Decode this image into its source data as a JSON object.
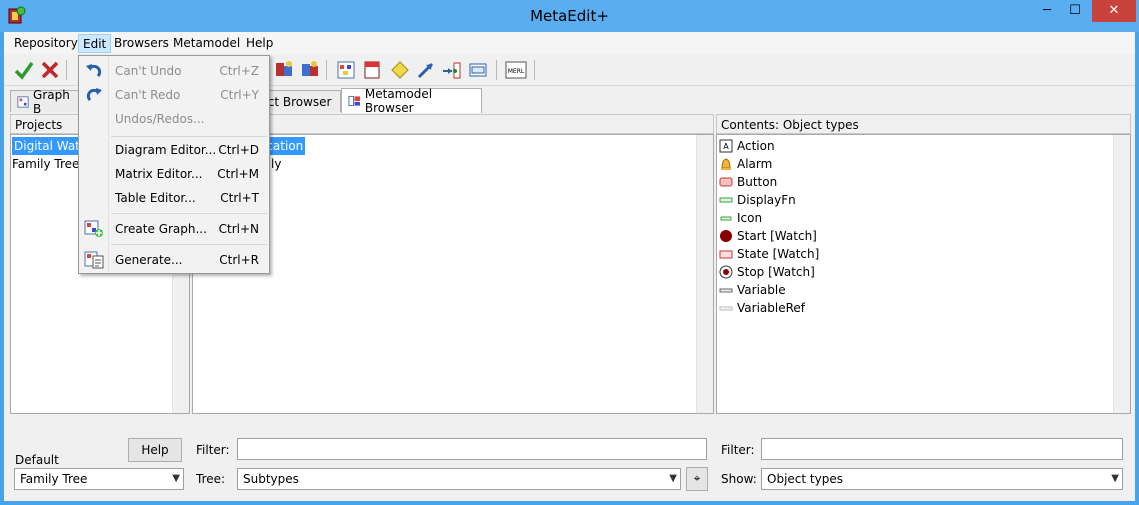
{
  "window": {
    "title": "MetaEdit+",
    "minimize": "─",
    "maximize": "☐",
    "close": "✕"
  },
  "menu": {
    "repository": "Repository",
    "edit": "Edit",
    "browsers": "Browsers",
    "metamodel": "Metamodel",
    "help": "Help"
  },
  "tabs": {
    "graph": "Graph B",
    "object": "ject Browser",
    "metamodel": "Metamodel Browser"
  },
  "projects": {
    "header": "Projects",
    "items": [
      "Digital Watch",
      "Family Tree"
    ],
    "selected": "Digital Watch",
    "default_label": "Default",
    "help_button": "Help",
    "default_value": "Family Tree"
  },
  "middle": {
    "items": [
      "ication",
      "ly"
    ],
    "filter_label": "Filter:",
    "filter_value": "",
    "tree_label": "Tree:",
    "tree_value": "Subtypes"
  },
  "contents": {
    "header": "Contents: Object types",
    "items": [
      {
        "label": "Action",
        "icon": "action-icon"
      },
      {
        "label": "Alarm",
        "icon": "alarm-icon"
      },
      {
        "label": "Button",
        "icon": "button-icon"
      },
      {
        "label": "DisplayFn",
        "icon": "displayfn-icon"
      },
      {
        "label": "Icon",
        "icon": "icon-type-icon"
      },
      {
        "label": "Start [Watch]",
        "icon": "start-icon"
      },
      {
        "label": "State [Watch]",
        "icon": "state-icon"
      },
      {
        "label": "Stop [Watch]",
        "icon": "stop-icon"
      },
      {
        "label": "Variable",
        "icon": "variable-icon"
      },
      {
        "label": "VariableRef",
        "icon": "variableref-icon"
      }
    ],
    "filter_label": "Filter:",
    "filter_value": "",
    "show_label": "Show:",
    "show_value": "Object types"
  },
  "edit_menu": {
    "undo": {
      "label": "Can't Undo",
      "shortcut": "Ctrl+Z"
    },
    "redo": {
      "label": "Can't Redo",
      "shortcut": "Ctrl+Y"
    },
    "undos": {
      "label": "Undos/Redos..."
    },
    "diagram": {
      "label": "Diagram Editor...",
      "shortcut": "Ctrl+D"
    },
    "matrix": {
      "label": "Matrix Editor...",
      "shortcut": "Ctrl+M"
    },
    "table": {
      "label": "Table Editor...",
      "shortcut": "Ctrl+T"
    },
    "create_graph": {
      "label": "Create Graph...",
      "shortcut": "Ctrl+N"
    },
    "generate": {
      "label": "Generate...",
      "shortcut": "Ctrl+R"
    }
  },
  "toolbar": {
    "merl": "MERL"
  },
  "colors": {
    "title_bar": "#58aef0",
    "selection": "#3399ff",
    "close": "#c8433b"
  }
}
